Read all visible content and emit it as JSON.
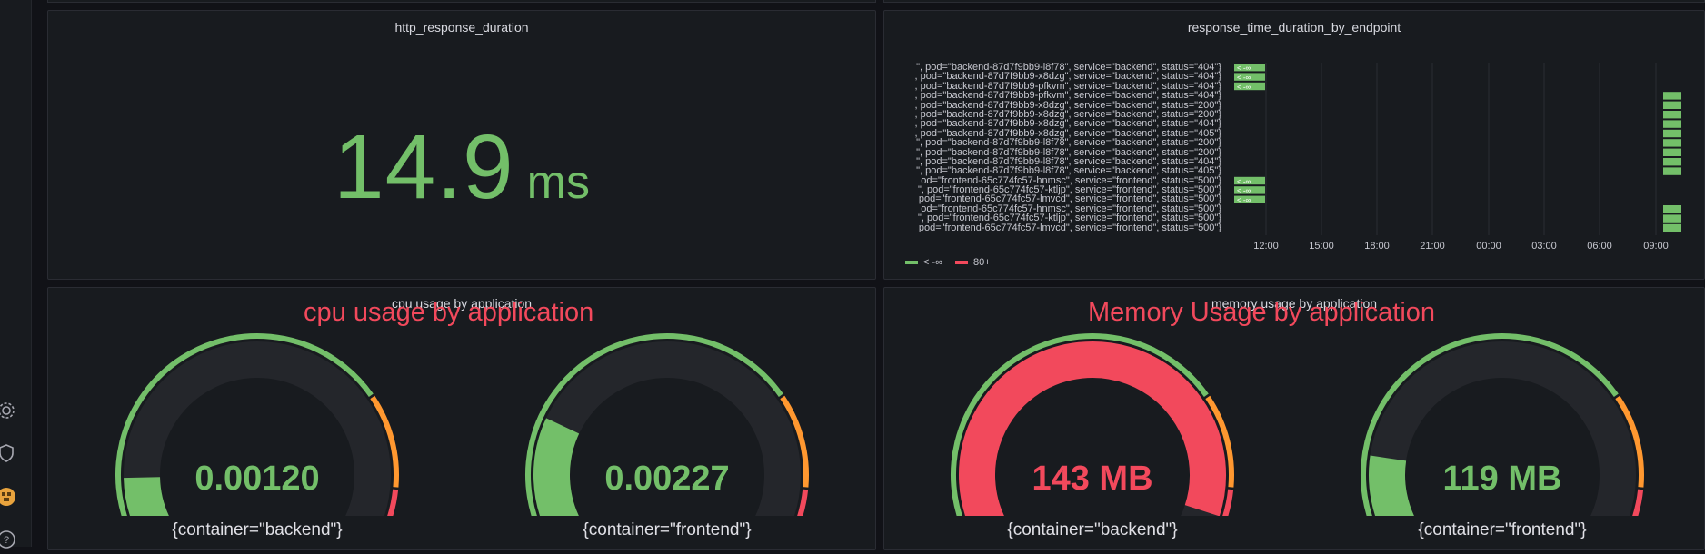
{
  "colors": {
    "green": "#73bf69",
    "red": "#f2495c",
    "orange": "#ff9830",
    "track": "#24262b"
  },
  "sidebar": {
    "icons": [
      "gear-icon",
      "shield-icon",
      "avatar",
      "help-icon"
    ]
  },
  "stat_panel": {
    "title": "http_response_duration",
    "value": "14.9",
    "unit": "ms"
  },
  "heatmap_panel": {
    "title": "response_time_duration_by_endpoint",
    "series_labels": [
      "\", pod=\"backend-87d7f9bb9-l8f78\", service=\"backend\", status=\"404\"}",
      ", pod=\"backend-87d7f9bb9-x8dzg\", service=\"backend\", status=\"404\"}",
      ", pod=\"backend-87d7f9bb9-pfkvm\", service=\"backend\", status=\"404\"}",
      ", pod=\"backend-87d7f9bb9-pfkvm\", service=\"backend\", status=\"404\"}",
      ", pod=\"backend-87d7f9bb9-x8dzg\", service=\"backend\", status=\"200\"}",
      ", pod=\"backend-87d7f9bb9-x8dzg\", service=\"backend\", status=\"200\"}",
      ", pod=\"backend-87d7f9bb9-x8dzg\", service=\"backend\", status=\"404\"}",
      ", pod=\"backend-87d7f9bb9-x8dzg\", service=\"backend\", status=\"405\"}",
      "\", pod=\"backend-87d7f9bb9-l8f78\", service=\"backend\", status=\"200\"}",
      "\", pod=\"backend-87d7f9bb9-l8f78\", service=\"backend\", status=\"200\"}",
      "\", pod=\"backend-87d7f9bb9-l8f78\", service=\"backend\", status=\"404\"}",
      "\", pod=\"backend-87d7f9bb9-l8f78\", service=\"backend\", status=\"405\"}",
      "od=\"frontend-65c774fc57-hnmsc\", service=\"frontend\", status=\"500\"}",
      "\", pod=\"frontend-65c774fc57-ktljp\", service=\"frontend\", status=\"500\"}",
      "pod=\"frontend-65c774fc57-lmvcd\", service=\"frontend\", status=\"500\"}",
      "od=\"frontend-65c774fc57-hnmsc\", service=\"frontend\", status=\"500\"}",
      "\", pod=\"frontend-65c774fc57-ktljp\", service=\"frontend\", status=\"500\"}",
      "pod=\"frontend-65c774fc57-lmvcd\", service=\"frontend\", status=\"500\"}"
    ],
    "cell_label": "< -∞",
    "labeled_rows": [
      0,
      1,
      2,
      12,
      13,
      14
    ],
    "right_bars_rows": [
      3,
      4,
      5,
      6,
      7,
      8,
      9,
      10,
      11,
      15,
      16,
      17
    ],
    "x_ticks": [
      "12:00",
      "15:00",
      "18:00",
      "21:00",
      "00:00",
      "03:00",
      "06:00",
      "09:00"
    ],
    "legend": [
      {
        "label": "< -∞",
        "color": "#73bf69"
      },
      {
        "label": "80+",
        "color": "#f2495c"
      }
    ]
  },
  "cpu_panel": {
    "title": "cpu usage by application",
    "overlay": "cpu usage by application",
    "gauges": [
      {
        "value": "0.00120",
        "label": "{container=\"backend\"}",
        "fill": 0.12,
        "color": "#73bf69"
      },
      {
        "value": "0.00227",
        "label": "{container=\"frontend\"}",
        "fill": 0.23,
        "color": "#73bf69"
      }
    ]
  },
  "memory_panel": {
    "title": "memory usage by application",
    "overlay": "Memory Usage by application",
    "gauges": [
      {
        "value": "143 MB",
        "label": "{container=\"backend\"}",
        "fill": 0.95,
        "color": "#f2495c"
      },
      {
        "value": "119 MB",
        "label": "{container=\"frontend\"}",
        "fill": 0.16,
        "color": "#73bf69"
      }
    ]
  }
}
